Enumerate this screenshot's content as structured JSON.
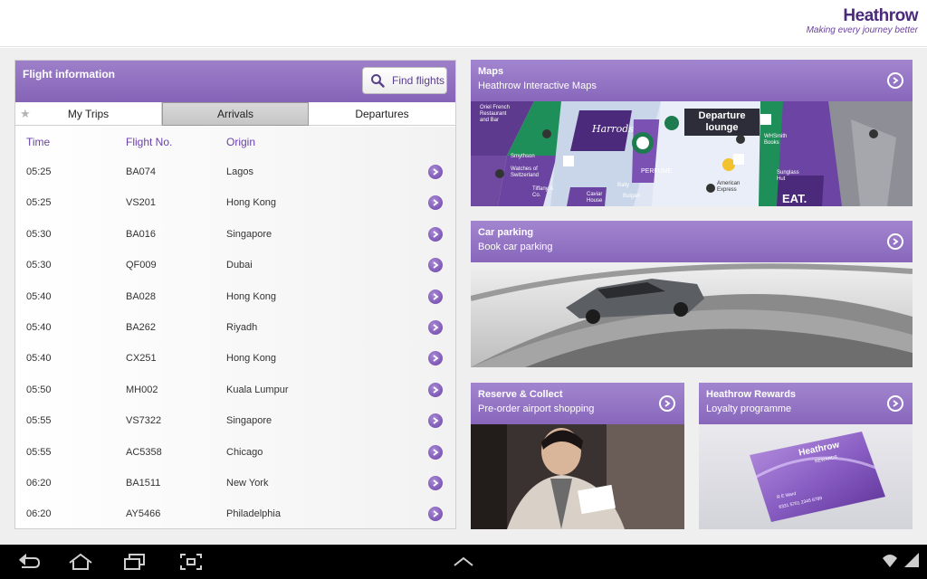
{
  "header": {
    "brand": "Heathrow",
    "tagline": "Making every journey better"
  },
  "flights": {
    "title": "Flight information",
    "find_label": "Find flights",
    "tabs": [
      "My Trips",
      "Arrivals",
      "Departures"
    ],
    "active_tab": "Arrivals",
    "columns": [
      "Time",
      "Flight No.",
      "Origin"
    ],
    "rows": [
      [
        "05:25",
        "BA074",
        "Lagos"
      ],
      [
        "05:25",
        "VS201",
        "Hong Kong"
      ],
      [
        "05:30",
        "BA016",
        "Singapore"
      ],
      [
        "05:30",
        "QF009",
        "Dubai"
      ],
      [
        "05:40",
        "BA028",
        "Hong Kong"
      ],
      [
        "05:40",
        "BA262",
        "Riyadh"
      ],
      [
        "05:40",
        "CX251",
        "Hong Kong"
      ],
      [
        "05:50",
        "MH002",
        "Kuala Lumpur"
      ],
      [
        "05:55",
        "VS7322",
        "Singapore"
      ],
      [
        "05:55",
        "AC5358",
        "Chicago"
      ],
      [
        "06:20",
        "BA1511",
        "New York"
      ],
      [
        "06:20",
        "AY5466",
        "Philadelphia"
      ]
    ]
  },
  "cards": {
    "maps": {
      "title": "Maps",
      "subtitle": "Heathrow Interactive Maps"
    },
    "parking": {
      "title": "Car parking",
      "subtitle": "Book car parking"
    },
    "reserve": {
      "title": "Reserve & Collect",
      "subtitle": "Pre-order airport shopping"
    },
    "rewards": {
      "title": "Heathrow Rewards",
      "subtitle": "Loyalty programme"
    }
  },
  "map": {
    "lounge": "Departure lounge",
    "harrods": "Harrods",
    "perfume": "PERFUME",
    "eat": "EAT.",
    "oriel": "Oriel French Restaurant and Bar",
    "smythson": "Smythson",
    "watches": "Watches of Switzerland",
    "tiffany": "Tiffany & Co.",
    "caviar": "Caviar House",
    "bally": "Bally",
    "bulgari": "Bulgari",
    "amex": "American Express",
    "whsmith": "WHSmith Books",
    "sunglass": "Sunglass Hut"
  },
  "rewards_card": {
    "brand": "Heathrow",
    "sub": "REWARDS",
    "holder": "R E Ward",
    "number": "6331 5701 2345 6789"
  },
  "colors": {
    "accent": "#8a6abd",
    "brand": "#4b2a7b",
    "nav_bg": "#000000"
  }
}
